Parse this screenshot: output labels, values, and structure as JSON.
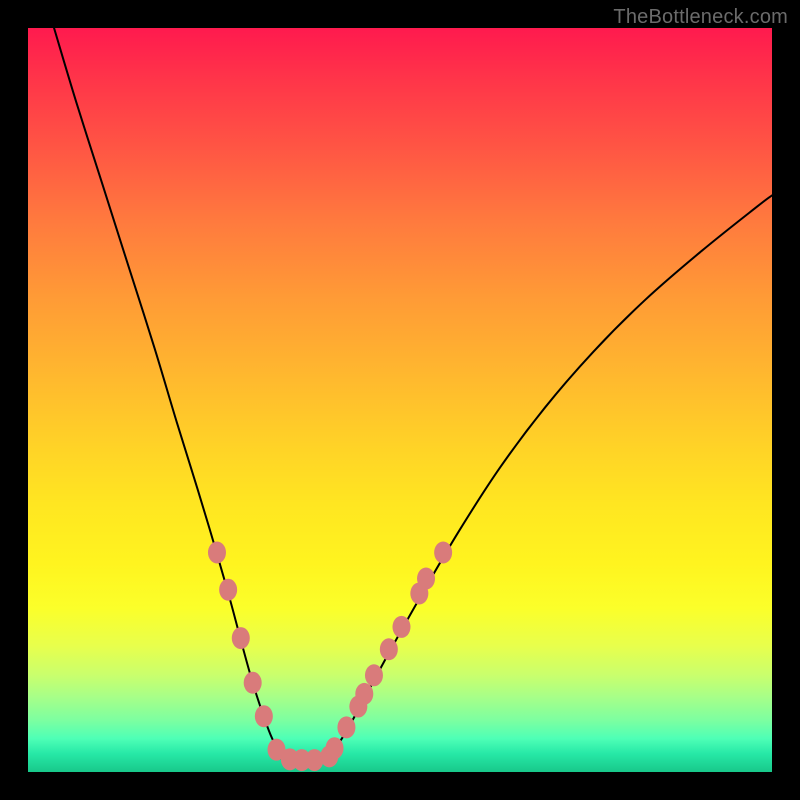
{
  "watermark": "TheBottleneck.com",
  "colors": {
    "frame": "#000000",
    "curve": "#000000",
    "dot_fill": "#d97b7b",
    "dot_stroke": "#c46565"
  },
  "chart_data": {
    "type": "line",
    "title": "",
    "xlabel": "",
    "ylabel": "",
    "xlim": [
      0,
      100
    ],
    "ylim": [
      0,
      100
    ],
    "grid": false,
    "legend": false,
    "note": "Values are approximate pixel-percentage positions read from the image (x%, y% of inner plot area). y=0 is top.",
    "series": [
      {
        "name": "left-branch",
        "x": [
          3.5,
          6.5,
          10.0,
          13.5,
          17.0,
          20.0,
          22.8,
          25.2,
          27.2,
          28.8,
          30.2,
          31.5,
          32.6,
          34.0
        ],
        "y": [
          0.0,
          10.0,
          21.0,
          32.0,
          43.0,
          53.0,
          62.0,
          70.0,
          77.0,
          83.0,
          88.0,
          92.0,
          95.0,
          98.0
        ]
      },
      {
        "name": "valley-floor",
        "x": [
          34.0,
          35.2,
          36.5,
          37.8,
          39.2,
          40.5
        ],
        "y": [
          98.0,
          98.3,
          98.4,
          98.4,
          98.3,
          97.9
        ]
      },
      {
        "name": "right-branch",
        "x": [
          40.5,
          42.5,
          45.0,
          48.5,
          53.0,
          58.0,
          63.5,
          69.5,
          76.0,
          83.0,
          90.5,
          98.0,
          100.0
        ],
        "y": [
          97.9,
          95.0,
          90.5,
          84.0,
          76.0,
          67.5,
          59.0,
          51.0,
          43.5,
          36.5,
          30.0,
          24.0,
          22.5
        ]
      }
    ],
    "dots": {
      "name": "highlighted-points",
      "points": [
        {
          "x": 25.4,
          "y": 70.5
        },
        {
          "x": 26.9,
          "y": 75.5
        },
        {
          "x": 28.6,
          "y": 82.0
        },
        {
          "x": 30.2,
          "y": 88.0
        },
        {
          "x": 31.7,
          "y": 92.5
        },
        {
          "x": 33.4,
          "y": 97.0
        },
        {
          "x": 35.2,
          "y": 98.3
        },
        {
          "x": 36.8,
          "y": 98.4
        },
        {
          "x": 38.5,
          "y": 98.4
        },
        {
          "x": 40.5,
          "y": 97.9
        },
        {
          "x": 41.2,
          "y": 96.8
        },
        {
          "x": 42.8,
          "y": 94.0
        },
        {
          "x": 44.4,
          "y": 91.2
        },
        {
          "x": 45.2,
          "y": 89.5
        },
        {
          "x": 46.5,
          "y": 87.0
        },
        {
          "x": 48.5,
          "y": 83.5
        },
        {
          "x": 50.2,
          "y": 80.5
        },
        {
          "x": 52.6,
          "y": 76.0
        },
        {
          "x": 53.5,
          "y": 74.0
        },
        {
          "x": 55.8,
          "y": 70.5
        }
      ]
    }
  }
}
